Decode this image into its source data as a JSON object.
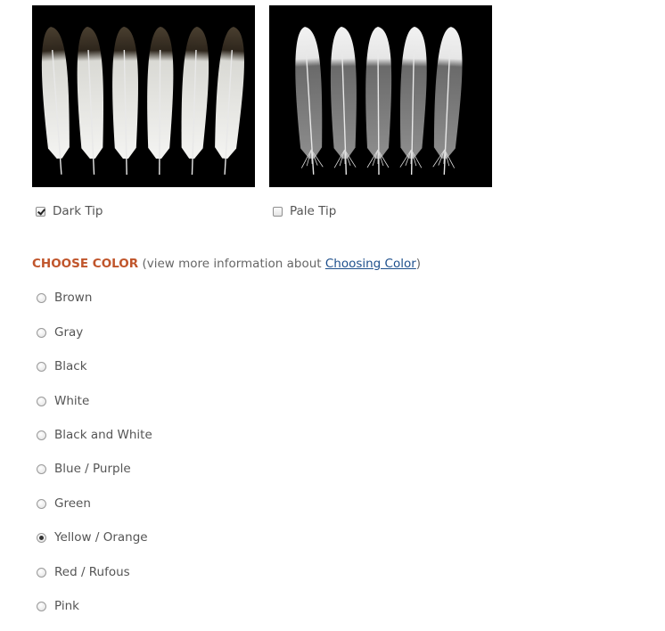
{
  "tip_options": [
    {
      "label": "Dark Tip",
      "checked": true,
      "image": "dark-tipped-feathers-photo"
    },
    {
      "label": "Pale Tip",
      "checked": false,
      "image": "pale-tipped-feathers-photo"
    }
  ],
  "choose_color": {
    "heading": "CHOOSE COLOR",
    "note_prefix": "(view more information about ",
    "link_text": "Choosing Color",
    "note_suffix": ")",
    "heading_color": "#c0552b",
    "link_color": "#1d4f8c"
  },
  "colors": [
    {
      "label": "Brown",
      "checked": false
    },
    {
      "label": "Gray",
      "checked": false
    },
    {
      "label": "Black",
      "checked": false
    },
    {
      "label": "White",
      "checked": false
    },
    {
      "label": "Black and White",
      "checked": false
    },
    {
      "label": "Blue / Purple",
      "checked": false
    },
    {
      "label": "Green",
      "checked": false
    },
    {
      "label": "Yellow / Orange",
      "checked": true
    },
    {
      "label": "Red / Rufous",
      "checked": false
    },
    {
      "label": "Pink",
      "checked": false
    }
  ]
}
